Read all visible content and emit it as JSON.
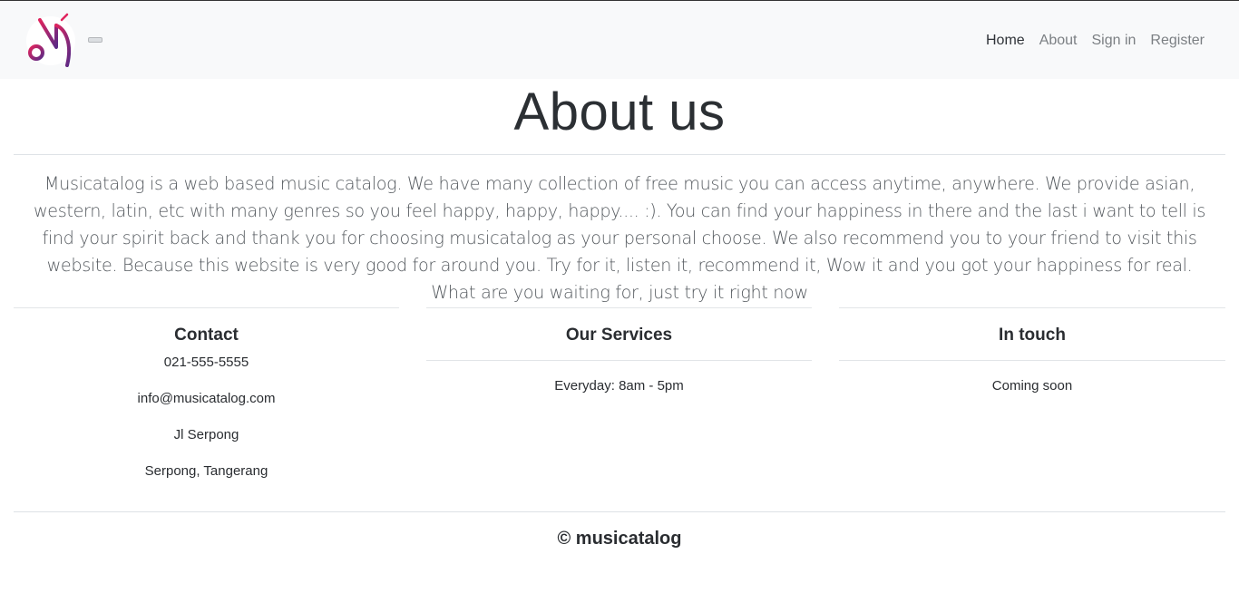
{
  "colors": {
    "navbar_bg": "#f8f9fa",
    "logo_gradient_start": "#e0245e",
    "logo_gradient_end": "#5b2a86",
    "text": "#212529",
    "muted_nav": "#7b7f83"
  },
  "navbar": {
    "logo_icon": "musicatalog-logo-icon",
    "toggler_icon": "menu-toggle-icon",
    "links": [
      {
        "label": "Home",
        "active": true
      },
      {
        "label": "About",
        "active": false
      },
      {
        "label": "Sign in",
        "active": false
      },
      {
        "label": "Register",
        "active": false
      }
    ]
  },
  "page": {
    "title": "About us",
    "description": "Musicatalog is a web based music catalog. We have many collection of free music you can access anytime, anywhere. We provide asian, western, latin, etc with many genres so you feel happy, happy, happy.... :). You can find your happiness in there and the last i want to tell is find your spirit back and thank you for choosing musicatalog as your personal choose. We also recommend you to your friend to visit this website. Because this website is very good for around you. Try for it, listen it, recommend it, Wow it and you got your happiness for real. What are you waiting for, just try it right now"
  },
  "contact": {
    "heading": "Contact",
    "lines": [
      "021-555-5555",
      "info@musicatalog.com",
      "Jl Serpong",
      "Serpong, Tangerang"
    ]
  },
  "services": {
    "heading": "Our Services",
    "text": "Everyday: 8am - 5pm"
  },
  "touch": {
    "heading": "In touch",
    "text": "Coming soon"
  },
  "footer": {
    "text": "© musicatalog"
  }
}
